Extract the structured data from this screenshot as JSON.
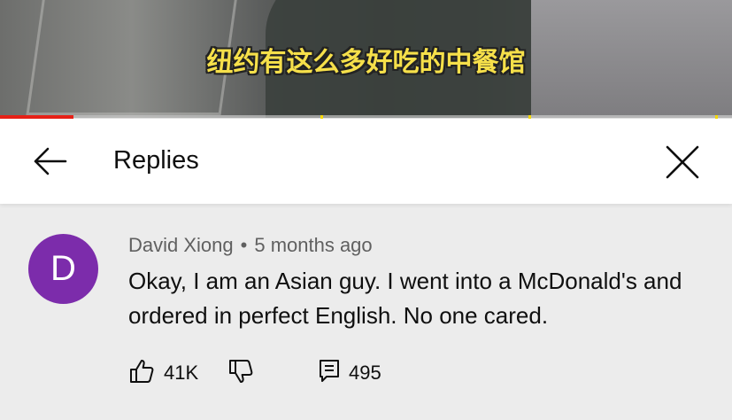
{
  "video": {
    "caption": "纽约有这么多好吃的中餐馆",
    "progress_fraction": 0.1
  },
  "header": {
    "title": "Replies"
  },
  "comment": {
    "avatar_letter": "D",
    "avatar_color": "#7c2cab",
    "author": "David Xiong",
    "separator": "•",
    "time": "5 months ago",
    "text": "Okay, I am an Asian guy. I went into a McDonald's and ordered in perfect English. No one cared.",
    "likes": "41K",
    "replies": "495"
  },
  "colors": {
    "accent_progress": "#e62117",
    "caption": "#f6e04a",
    "background": "#ececec"
  }
}
